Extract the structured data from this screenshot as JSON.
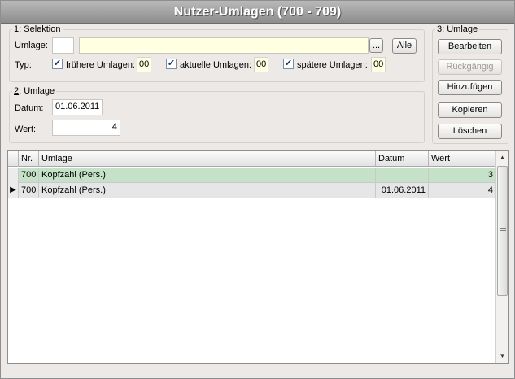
{
  "window": {
    "title": "Nutzer-Umlagen  (700 - 709)"
  },
  "selektion": {
    "group_number": "1",
    "group_label": ": Selektion",
    "umlage_label": "Umlage:",
    "umlage_code": "",
    "umlage_text": "",
    "browse_label": "...",
    "alle_label": "Alle",
    "typ_label": "Typ:",
    "checkboxes": [
      {
        "label": "frühere Umlagen:",
        "checked": true,
        "value": "00"
      },
      {
        "label": "aktuelle Umlagen:",
        "checked": true,
        "value": "00"
      },
      {
        "label": "spätere Umlagen:",
        "checked": true,
        "value": "00"
      }
    ]
  },
  "umlage_edit": {
    "group_number": "2",
    "group_label": ": Umlage",
    "datum_label": "Datum:",
    "datum_value": "01.06.2011",
    "wert_label": "Wert:",
    "wert_value": "4"
  },
  "actions": {
    "group_number": "3",
    "group_label": ": Umlage",
    "buttons": [
      {
        "label": "Bearbeiten",
        "enabled": true
      },
      {
        "label": "Rückgängig",
        "enabled": false
      },
      {
        "label": "Hinzufügen",
        "enabled": true
      },
      {
        "label": "Kopieren",
        "enabled": true
      },
      {
        "label": "Löschen",
        "enabled": true
      }
    ]
  },
  "table": {
    "columns": [
      "Nr.",
      "Umlage",
      "Datum",
      "Wert"
    ],
    "rows": [
      {
        "indicator": "",
        "nr": "700",
        "umlage": "Kopfzahl (Pers.)",
        "datum": "",
        "wert": "3",
        "highlight": "green"
      },
      {
        "indicator": "▶",
        "nr": "700",
        "umlage": "Kopfzahl (Pers.)",
        "datum": "01.06.2011",
        "wert": "4",
        "highlight": "grey"
      }
    ]
  },
  "checkmark": "✔",
  "icons": {
    "scroll_up": "▲",
    "scroll_down": "▼"
  },
  "colors": {
    "row_highlight_green": "#c5e2c8",
    "row_current_grey": "#e6e6e6",
    "input_yellow": "#ffffe1"
  }
}
